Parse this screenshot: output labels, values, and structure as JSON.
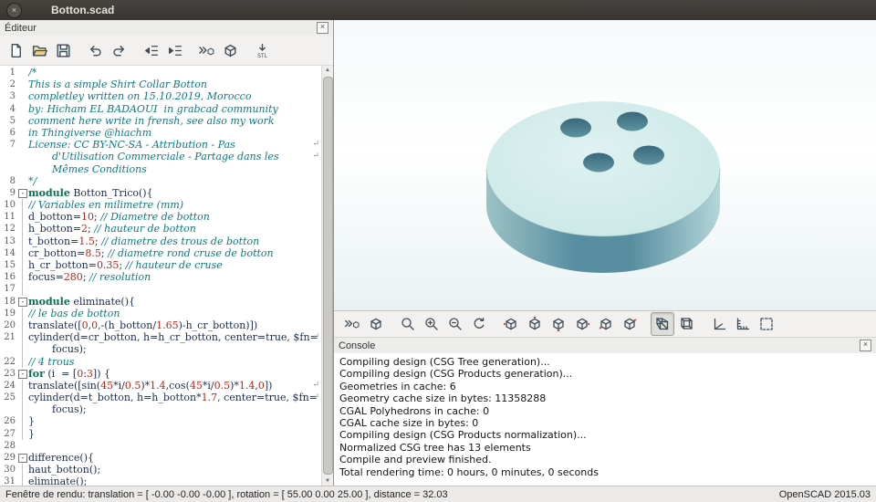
{
  "titlebar": {
    "title": "Botton.scad"
  },
  "icons": {
    "close": "×",
    "wrap_marker": "↵",
    "fold_collapse": "-",
    "scroll_up": "▲",
    "scroll_down": "▼"
  },
  "editor": {
    "dock_title": "Éditeur",
    "toolbar": [
      "new-file",
      "open-file",
      "save-file",
      "|",
      "undo",
      "redo",
      "|",
      "unindent",
      "indent",
      "|",
      "preview",
      "render",
      "|",
      "export-stl"
    ],
    "rows": [
      {
        "n": "1",
        "segs": [
          [
            "c",
            "/*"
          ]
        ]
      },
      {
        "n": "2",
        "segs": [
          [
            "c",
            "This is a simple Shirt Collar Botton"
          ]
        ]
      },
      {
        "n": "3",
        "segs": [
          [
            "c",
            "completley written on 15.10.2019, Morocco"
          ]
        ]
      },
      {
        "n": "4",
        "segs": [
          [
            "c",
            "by: Hicham EL BADAOUI  in grabcad community"
          ]
        ]
      },
      {
        "n": "5",
        "segs": [
          [
            "c",
            "comment here write in frensh, see also my work"
          ]
        ]
      },
      {
        "n": "6",
        "segs": [
          [
            "c",
            "in Thingiverse @hiachm"
          ]
        ]
      },
      {
        "n": "7",
        "wrap": true,
        "segs": [
          [
            "c",
            "License: CC BY-NC-SA - Attribution - Pas"
          ]
        ]
      },
      {
        "n": "",
        "ind": true,
        "wrap": true,
        "segs": [
          [
            "c",
            "d'Utilisation Commerciale - Partage dans les"
          ]
        ]
      },
      {
        "n": "",
        "ind": true,
        "segs": [
          [
            "c",
            "Mêmes Conditions"
          ]
        ]
      },
      {
        "n": "8",
        "segs": [
          [
            "c",
            "*/"
          ]
        ]
      },
      {
        "n": "9",
        "fold": true,
        "segs": [
          [
            "k",
            "module"
          ],
          [
            "p",
            " Botton_Trico(){"
          ]
        ]
      },
      {
        "n": "10",
        "g": true,
        "segs": [
          [
            "c",
            "// Variables en milimetre (mm)"
          ]
        ]
      },
      {
        "n": "11",
        "g": true,
        "segs": [
          [
            "p",
            "d_botton="
          ],
          [
            "n",
            "10"
          ],
          [
            "p",
            "; "
          ],
          [
            "c",
            "// Diametre de botton"
          ]
        ]
      },
      {
        "n": "12",
        "g": true,
        "segs": [
          [
            "p",
            "h_botton="
          ],
          [
            "n",
            "2"
          ],
          [
            "p",
            "; "
          ],
          [
            "c",
            "// hauteur de botton"
          ]
        ]
      },
      {
        "n": "13",
        "g": true,
        "segs": [
          [
            "p",
            "t_botton="
          ],
          [
            "n",
            "1.5"
          ],
          [
            "p",
            "; "
          ],
          [
            "c",
            "// diametre des trous de botton"
          ]
        ]
      },
      {
        "n": "14",
        "g": true,
        "segs": [
          [
            "p",
            "cr_botton="
          ],
          [
            "n",
            "8.5"
          ],
          [
            "p",
            "; "
          ],
          [
            "c",
            "// diametre rond cruse de botton"
          ]
        ]
      },
      {
        "n": "15",
        "g": true,
        "segs": [
          [
            "p",
            "h_cr_botton="
          ],
          [
            "n",
            "0.35"
          ],
          [
            "p",
            "; "
          ],
          [
            "c",
            "// hauteur de cruse"
          ]
        ]
      },
      {
        "n": "16",
        "g": true,
        "segs": [
          [
            "p",
            "focus="
          ],
          [
            "n",
            "280"
          ],
          [
            "p",
            "; "
          ],
          [
            "c",
            "// resolution"
          ]
        ]
      },
      {
        "n": "17",
        "g": true,
        "segs": []
      },
      {
        "n": "18",
        "fold": true,
        "segs": [
          [
            "k",
            "module"
          ],
          [
            "p",
            " eliminate(){"
          ]
        ]
      },
      {
        "n": "19",
        "g": true,
        "segs": [
          [
            "c",
            "// le bas de botton"
          ]
        ]
      },
      {
        "n": "20",
        "g": true,
        "segs": [
          [
            "p",
            "translate(["
          ],
          [
            "n",
            "0"
          ],
          [
            "p",
            ","
          ],
          [
            "n",
            "0"
          ],
          [
            "p",
            ",-(h_botton/"
          ],
          [
            "n",
            "1.65"
          ],
          [
            "p",
            ")-h_cr_botton)])"
          ]
        ]
      },
      {
        "n": "21",
        "g": true,
        "wrap": true,
        "segs": [
          [
            "p",
            "cylinder(d=cr_botton, h=h_cr_botton, center=true, $fn="
          ]
        ]
      },
      {
        "n": "",
        "g": true,
        "ind": true,
        "segs": [
          [
            "p",
            "focus);"
          ]
        ]
      },
      {
        "n": "22",
        "g": true,
        "segs": [
          [
            "c",
            "// 4 trous"
          ]
        ]
      },
      {
        "n": "23",
        "fold": true,
        "segs": [
          [
            "k",
            "for"
          ],
          [
            "p",
            " (i  = ["
          ],
          [
            "n",
            "0"
          ],
          [
            "p",
            ":"
          ],
          [
            "n",
            "3"
          ],
          [
            "p",
            "]) {"
          ]
        ]
      },
      {
        "n": "24",
        "g": true,
        "wrap": true,
        "segs": [
          [
            "p",
            "translate([sin("
          ],
          [
            "n",
            "45"
          ],
          [
            "p",
            "*i/"
          ],
          [
            "n",
            "0.5"
          ],
          [
            "p",
            ")*"
          ],
          [
            "n",
            "1.4"
          ],
          [
            "p",
            ",cos("
          ],
          [
            "n",
            "45"
          ],
          [
            "p",
            "*i/"
          ],
          [
            "n",
            "0.5"
          ],
          [
            "p",
            ")*"
          ],
          [
            "n",
            "1.4"
          ],
          [
            "p",
            ","
          ],
          [
            "n",
            "0"
          ],
          [
            "p",
            "])"
          ]
        ]
      },
      {
        "n": "25",
        "g": true,
        "wrap": true,
        "segs": [
          [
            "p",
            "cylinder(d=t_botton, h=h_botton*"
          ],
          [
            "n",
            "1.7"
          ],
          [
            "p",
            ", center=true, $fn="
          ]
        ]
      },
      {
        "n": "",
        "g": true,
        "ind": true,
        "segs": [
          [
            "p",
            "focus);"
          ]
        ]
      },
      {
        "n": "26",
        "g": true,
        "segs": [
          [
            "p",
            "}"
          ]
        ]
      },
      {
        "n": "27",
        "g": true,
        "segs": [
          [
            "p",
            "}"
          ]
        ]
      },
      {
        "n": "28",
        "segs": []
      },
      {
        "n": "29",
        "fold": true,
        "segs": [
          [
            "p",
            "difference(){"
          ]
        ]
      },
      {
        "n": "30",
        "g": true,
        "segs": [
          [
            "p",
            "haut_botton();"
          ]
        ]
      },
      {
        "n": "31",
        "g": true,
        "segs": [
          [
            "p",
            "eliminate();"
          ]
        ]
      }
    ]
  },
  "viewport": {
    "colors": {
      "model_top": "#c6e6e5",
      "model_top_light": "#dff2f1",
      "model_side_light": "#9cc2c6",
      "model_side_dark": "#578ea0",
      "model_side_back": "#b5d6d9",
      "model_hole": "#5e93a0",
      "model_hole_dark": "#39687a",
      "background_top": "#f6fafa",
      "background_bottom": "#e9f2f3"
    }
  },
  "view_toolbar": {
    "items": [
      "preview",
      "render",
      "|",
      "view-all",
      "zoom-in",
      "zoom-out",
      "reset-view",
      "|",
      "view-right",
      "view-top",
      "view-bottom",
      "view-left",
      "view-front",
      "view-back",
      "|",
      "perspective",
      "orthogonal",
      "|",
      "show-axes",
      "show-scale-markers",
      "view-all-box"
    ],
    "pressed": "perspective"
  },
  "console": {
    "dock_title": "Console",
    "lines": [
      "Compiling design (CSG Tree generation)...",
      "Compiling design (CSG Products generation)...",
      "Geometries in cache: 6",
      "Geometry cache size in bytes: 11358288",
      "CGAL Polyhedrons in cache: 0",
      "CGAL cache size in bytes: 0",
      "Compiling design (CSG Products normalization)...",
      "Normalized CSG tree has 13 elements",
      "Compile and preview finished.",
      "Total rendering time: 0 hours, 0 minutes, 0 seconds"
    ]
  },
  "statusbar": {
    "left": "Fenêtre de rendu: translation = [ -0.00 -0.00 -0.00 ], rotation = [ 55.00 0.00 25.00 ], distance = 32.03",
    "right": "OpenSCAD 2015.03"
  }
}
